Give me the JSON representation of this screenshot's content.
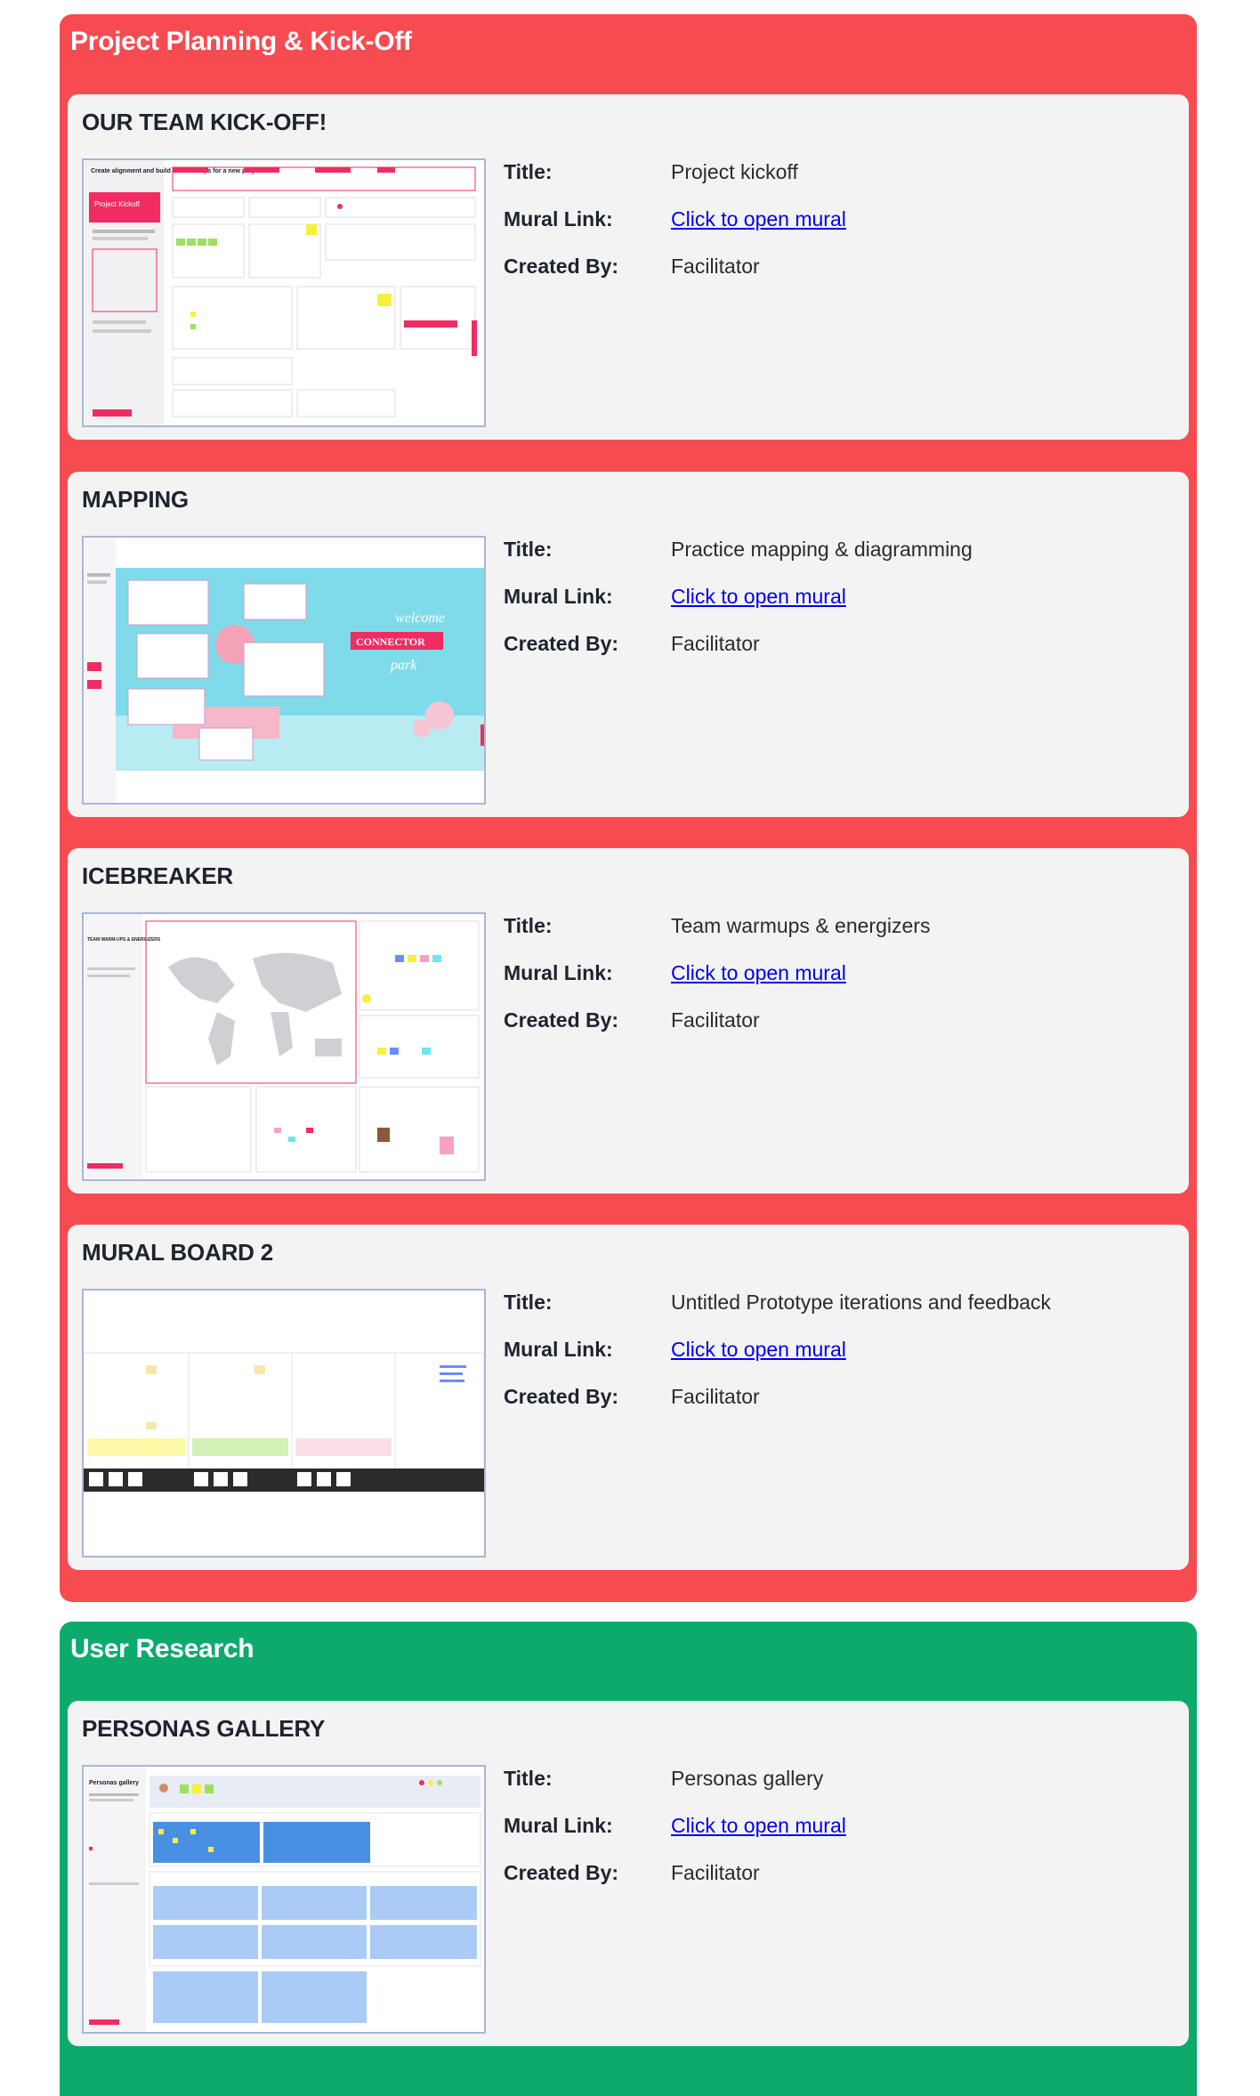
{
  "sections": [
    {
      "title": "Project Planning & Kick-Off",
      "color": "#f74b52",
      "cards": [
        {
          "heading": "OUR TEAM KICK-OFF!",
          "thumb_icon": "project-kickoff-mural-thumbnail",
          "title_label": "Title:",
          "title_value": "Project kickoff",
          "link_label": "Mural Link:",
          "link_text": "Click to open mural",
          "creator_label": "Created By:",
          "creator_value": "Facilitator"
        },
        {
          "heading": "MAPPING",
          "thumb_icon": "connector-park-mural-thumbnail",
          "title_label": "Title:",
          "title_value": "Practice mapping & diagramming",
          "link_label": "Mural Link:",
          "link_text": "Click to open mural",
          "creator_label": "Created By:",
          "creator_value": "Facilitator"
        },
        {
          "heading": "ICEBREAKER",
          "thumb_icon": "world-map-mural-thumbnail",
          "title_label": "Title:",
          "title_value": "Team warmups & energizers",
          "link_label": "Mural Link:",
          "link_text": "Click to open mural",
          "creator_label": "Created By:",
          "creator_value": "Facilitator"
        },
        {
          "heading": "MURAL BOARD 2",
          "thumb_icon": "prototype-board-mural-thumbnail",
          "title_label": "Title:",
          "title_value": "Untitled Prototype iterations and feedback",
          "link_label": "Mural Link:",
          "link_text": "Click to open mural",
          "creator_label": "Created By:",
          "creator_value": "Facilitator"
        }
      ]
    },
    {
      "title": "User Research",
      "color": "#0cab6b",
      "cards": [
        {
          "heading": "PERSONAS GALLERY",
          "thumb_icon": "personas-gallery-mural-thumbnail",
          "title_label": "Title:",
          "title_value": "Personas gallery",
          "link_label": "Mural Link:",
          "link_text": "Click to open mural",
          "creator_label": "Created By:",
          "creator_value": "Facilitator"
        }
      ]
    }
  ],
  "thumbnail_text": {
    "kickoff_heading": "Create alignment and build relationships for a new project",
    "kickoff_badge": "Project Kickoff",
    "connector_welcome": "welcome",
    "connector_brand": "CONNECTOR",
    "connector_park": "park",
    "icebreaker_heading": "TEAM WARM-UPS & ENERGIZERS",
    "personas_heading": "Personas gallery"
  }
}
